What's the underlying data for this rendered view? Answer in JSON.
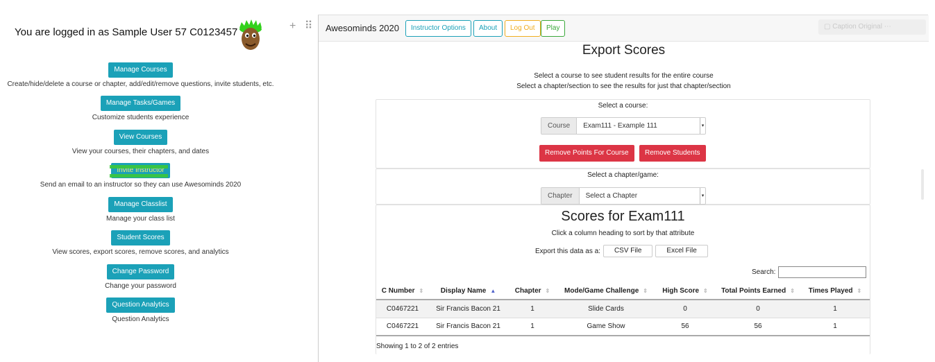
{
  "login": {
    "text": "You are logged in as Sample User 57  C0123457"
  },
  "menu": [
    {
      "label": "Manage Courses",
      "desc": "Create/hide/delete a course or chapter, add/edit/remove questions, invite students, etc."
    },
    {
      "label": "Manage Tasks/Games",
      "desc": "Customize students experience"
    },
    {
      "label": "View Courses",
      "desc": "View your courses, their chapters, and dates"
    },
    {
      "label": "Invite Instructor",
      "desc": "Send an email to an instructor so they can use Awesominds 2020"
    },
    {
      "label": "Manage Classlist",
      "desc": "Manage your class list"
    },
    {
      "label": "Student Scores",
      "desc": "View scores, export scores, remove scores, and analytics"
    },
    {
      "label": "Change Password",
      "desc": "Change your password"
    },
    {
      "label": "Question Analytics",
      "desc": "Question Analytics"
    }
  ],
  "edge_controls": "+ ⠿",
  "navbar": {
    "brand": "Awesominds 2020",
    "instructor_options": "Instructor Options",
    "about": "About",
    "logout": "Log Out",
    "play": "Play",
    "overlay": "▢   Caption   Original   ⋯"
  },
  "export": {
    "title": "Export Scores",
    "instr1": "Select a course to see student results for the entire course",
    "instr2": "Select a chapter/section to see the results for just that chapter/section",
    "select_course_label": "Select a course:",
    "course_addon": "Course",
    "course_value": "Exam111 - Example 111",
    "remove_points": "Remove Points For Course",
    "remove_students": "Remove Students",
    "select_chapter_label": "Select a chapter/game:",
    "chapter_addon": "Chapter",
    "chapter_value": "Select a Chapter"
  },
  "scores": {
    "title": "Scores for Exam111",
    "sort_hint": "Click a column heading to sort by that attribute",
    "export_label": "Export this data as a:",
    "csv": "CSV File",
    "excel": "Excel File",
    "search_label": "Search:",
    "columns": [
      "C Number",
      "Display Name",
      "Chapter",
      "Mode/Game Challenge",
      "High Score",
      "Total Points Earned",
      "Times Played"
    ],
    "rows": [
      [
        "C0467221",
        "Sir Francis Bacon 21",
        "1",
        "Slide Cards",
        "0",
        "0",
        "1"
      ],
      [
        "C0467221",
        "Sir Francis Bacon 21",
        "1",
        "Game Show",
        "56",
        "56",
        "1"
      ]
    ],
    "showing": "Showing 1 to 2 of 2 entries"
  },
  "colors": {
    "teal": "#1ba1b8",
    "danger": "#dc3545",
    "warning": "#f0ad1e",
    "success": "#3aa83a"
  }
}
